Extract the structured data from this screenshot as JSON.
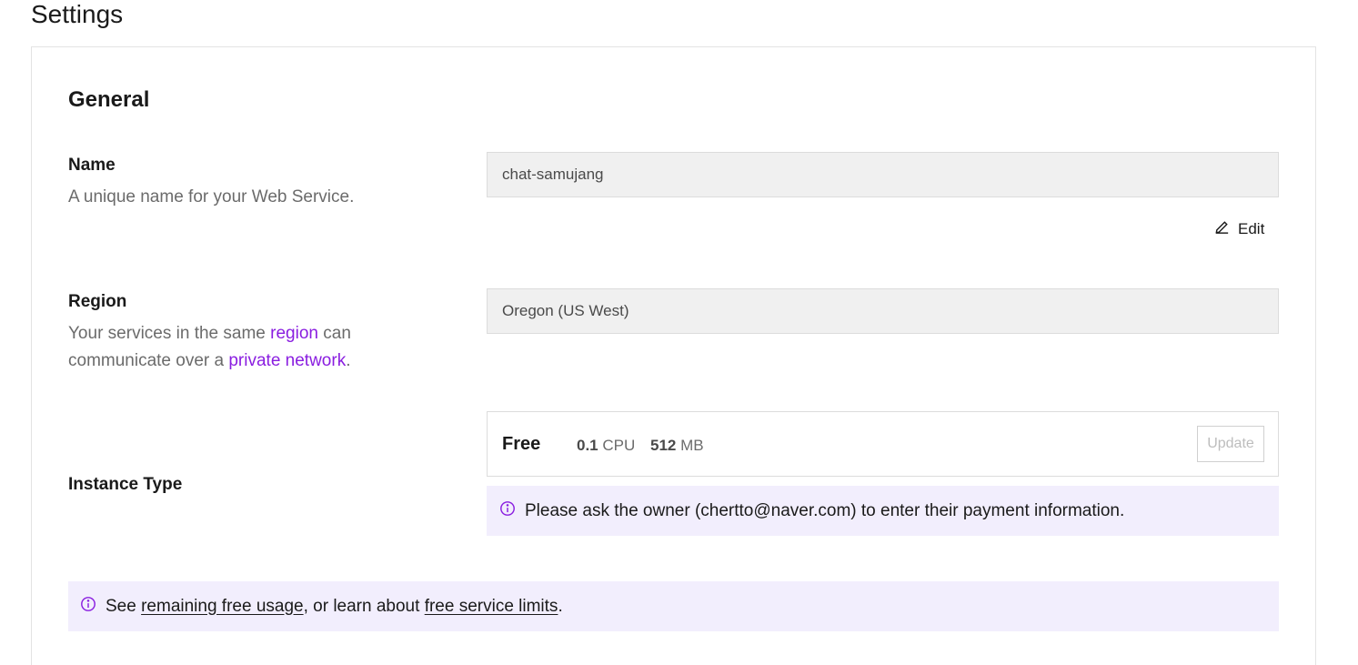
{
  "page": {
    "title": "Settings"
  },
  "general": {
    "title": "General",
    "name": {
      "label": "Name",
      "description": "A unique name for your Web Service.",
      "value": "chat-samujang",
      "edit_label": "Edit"
    },
    "region": {
      "label": "Region",
      "desc_part1": "Your services in the same ",
      "desc_link1": "region",
      "desc_part2": " can communicate over a ",
      "desc_link2": "private network",
      "desc_part3": ".",
      "value": "Oregon (US West)"
    },
    "instance": {
      "label": "Instance Type",
      "plan": "Free",
      "cpu_value": "0.1",
      "cpu_unit": "CPU",
      "mem_value": "512",
      "mem_unit": "MB",
      "update_label": "Update",
      "payment_notice": "Please ask the owner (chertto@naver.com) to enter their payment information."
    },
    "usage_notice": {
      "prefix": "See ",
      "link1": "remaining free usage",
      "middle": ", or learn about ",
      "link2": "free service limits",
      "suffix": "."
    }
  },
  "colors": {
    "accent": "#8a1ee0",
    "notice_bg": "#f2eefd"
  },
  "icons": {
    "edit": "pencil-icon",
    "info": "info-circle-icon"
  }
}
